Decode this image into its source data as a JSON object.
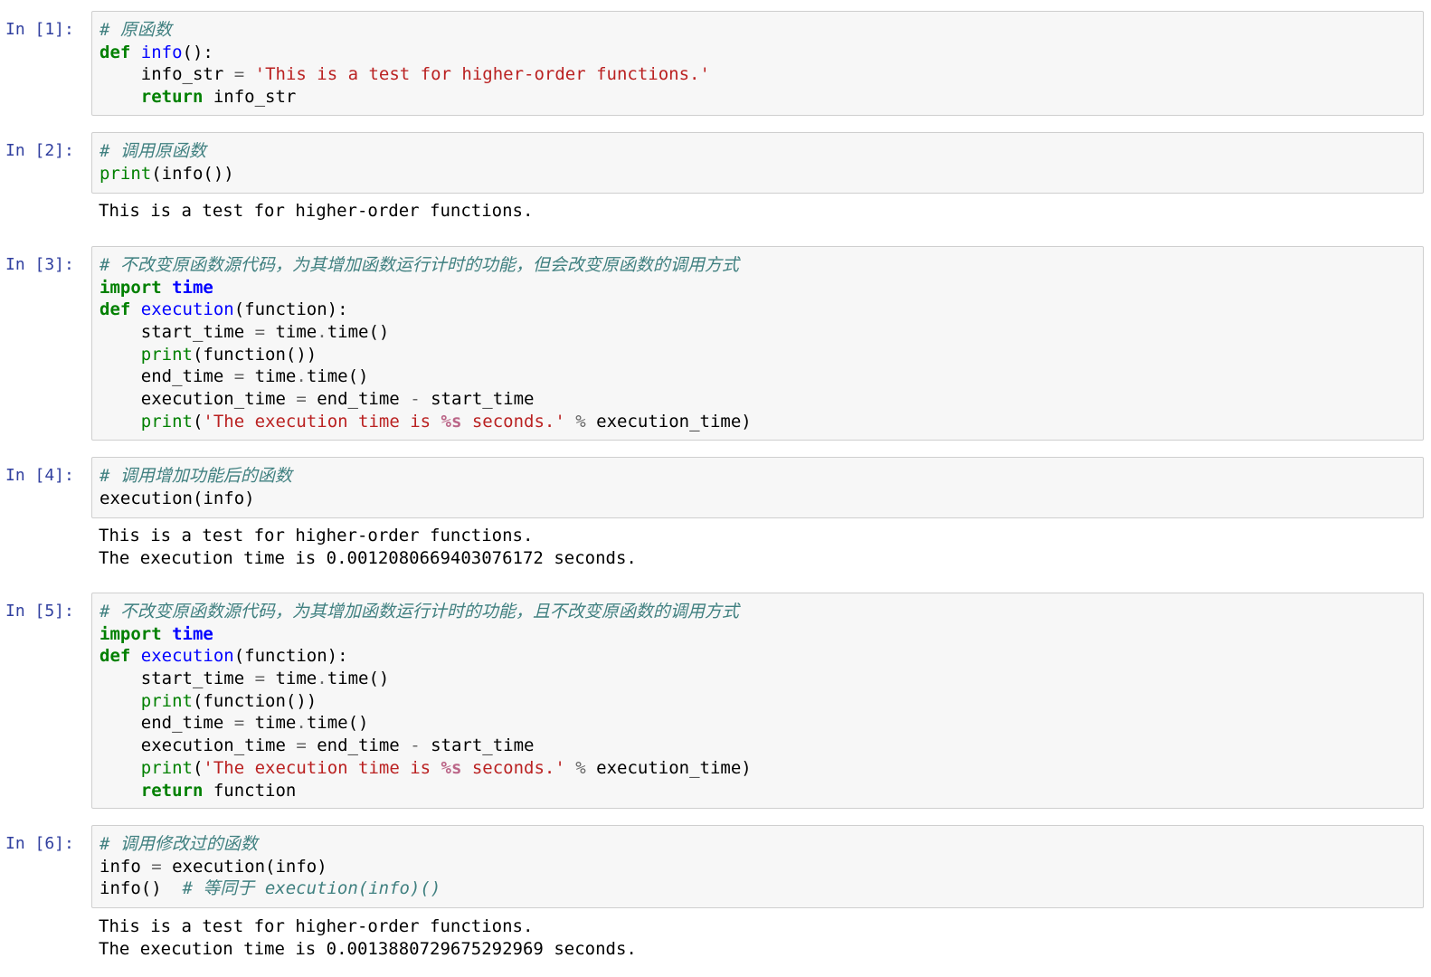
{
  "theme": {
    "prompt_color": "#303f9f",
    "input_bg": "#f7f7f7",
    "input_border": "#cfcfcf",
    "comment": "#408080",
    "keyword": "#008000",
    "function_name": "#0000ff",
    "string": "#ba2121",
    "interpolation": "#bb6688",
    "operator": "#666666"
  },
  "cells": [
    {
      "prompt": "In [1]:",
      "code": [
        [
          [
            "c",
            "# 原函数"
          ]
        ],
        [
          [
            "k",
            "def"
          ],
          [
            "",
            " "
          ],
          [
            "nf",
            "info"
          ],
          [
            "",
            "():"
          ]
        ],
        [
          [
            "",
            "    info_str "
          ],
          [
            "o",
            "="
          ],
          [
            "",
            " "
          ],
          [
            "s",
            "'This is a test for higher-order functions.'"
          ]
        ],
        [
          [
            "",
            "    "
          ],
          [
            "k",
            "return"
          ],
          [
            "",
            " info_str"
          ]
        ]
      ],
      "output": []
    },
    {
      "prompt": "In [2]:",
      "code": [
        [
          [
            "c",
            "# 调用原函数"
          ]
        ],
        [
          [
            "nb",
            "print"
          ],
          [
            "",
            "(info())"
          ]
        ]
      ],
      "output": [
        "This is a test for higher-order functions."
      ]
    },
    {
      "prompt": "In [3]:",
      "code": [
        [
          [
            "c",
            "# 不改变原函数源代码，为其增加函数运行计时的功能，但会改变原函数的调用方式"
          ]
        ],
        [
          [
            "k",
            "import"
          ],
          [
            "",
            " "
          ],
          [
            "nn",
            "time"
          ]
        ],
        [
          [
            "k",
            "def"
          ],
          [
            "",
            " "
          ],
          [
            "nf",
            "execution"
          ],
          [
            "",
            "(function):"
          ]
        ],
        [
          [
            "",
            "    start_time "
          ],
          [
            "o",
            "="
          ],
          [
            "",
            " time"
          ],
          [
            "o",
            "."
          ],
          [
            "",
            "time()"
          ]
        ],
        [
          [
            "",
            "    "
          ],
          [
            "nb",
            "print"
          ],
          [
            "",
            "(function())"
          ]
        ],
        [
          [
            "",
            "    end_time "
          ],
          [
            "o",
            "="
          ],
          [
            "",
            " time"
          ],
          [
            "o",
            "."
          ],
          [
            "",
            "time()"
          ]
        ],
        [
          [
            "",
            "    execution_time "
          ],
          [
            "o",
            "="
          ],
          [
            "",
            " end_time "
          ],
          [
            "o",
            "-"
          ],
          [
            "",
            " start_time"
          ]
        ],
        [
          [
            "",
            "    "
          ],
          [
            "nb",
            "print"
          ],
          [
            "",
            "("
          ],
          [
            "s",
            "'The execution time is "
          ],
          [
            "si",
            "%s"
          ],
          [
            "s",
            " seconds.'"
          ],
          [
            "",
            " "
          ],
          [
            "o",
            "%"
          ],
          [
            "",
            " execution_time)"
          ]
        ]
      ],
      "output": []
    },
    {
      "prompt": "In [4]:",
      "code": [
        [
          [
            "c",
            "# 调用增加功能后的函数"
          ]
        ],
        [
          [
            "",
            "execution(info)"
          ]
        ]
      ],
      "output": [
        "This is a test for higher-order functions.",
        "The execution time is 0.0012080669403076172 seconds."
      ]
    },
    {
      "prompt": "In [5]:",
      "code": [
        [
          [
            "c",
            "# 不改变原函数源代码，为其增加函数运行计时的功能，且不改变原函数的调用方式"
          ]
        ],
        [
          [
            "k",
            "import"
          ],
          [
            "",
            " "
          ],
          [
            "nn",
            "time"
          ]
        ],
        [
          [
            "k",
            "def"
          ],
          [
            "",
            " "
          ],
          [
            "nf",
            "execution"
          ],
          [
            "",
            "(function):"
          ]
        ],
        [
          [
            "",
            "    start_time "
          ],
          [
            "o",
            "="
          ],
          [
            "",
            " time"
          ],
          [
            "o",
            "."
          ],
          [
            "",
            "time()"
          ]
        ],
        [
          [
            "",
            "    "
          ],
          [
            "nb",
            "print"
          ],
          [
            "",
            "(function())"
          ]
        ],
        [
          [
            "",
            "    end_time "
          ],
          [
            "o",
            "="
          ],
          [
            "",
            " time"
          ],
          [
            "o",
            "."
          ],
          [
            "",
            "time()"
          ]
        ],
        [
          [
            "",
            "    execution_time "
          ],
          [
            "o",
            "="
          ],
          [
            "",
            " end_time "
          ],
          [
            "o",
            "-"
          ],
          [
            "",
            " start_time"
          ]
        ],
        [
          [
            "",
            "    "
          ],
          [
            "nb",
            "print"
          ],
          [
            "",
            "("
          ],
          [
            "s",
            "'The execution time is "
          ],
          [
            "si",
            "%s"
          ],
          [
            "s",
            " seconds.'"
          ],
          [
            "",
            " "
          ],
          [
            "o",
            "%"
          ],
          [
            "",
            " execution_time)"
          ]
        ],
        [
          [
            "",
            "    "
          ],
          [
            "k",
            "return"
          ],
          [
            "",
            " function"
          ]
        ]
      ],
      "output": []
    },
    {
      "prompt": "In [6]:",
      "code": [
        [
          [
            "c",
            "# 调用修改过的函数"
          ]
        ],
        [
          [
            "",
            "info "
          ],
          [
            "o",
            "="
          ],
          [
            "",
            " execution(info)"
          ]
        ],
        [
          [
            "",
            "info()  "
          ],
          [
            "c",
            "# 等同于 execution(info)()"
          ]
        ]
      ],
      "output": [
        "This is a test for higher-order functions.",
        "The execution time is 0.0013880729675292969 seconds."
      ]
    }
  ]
}
